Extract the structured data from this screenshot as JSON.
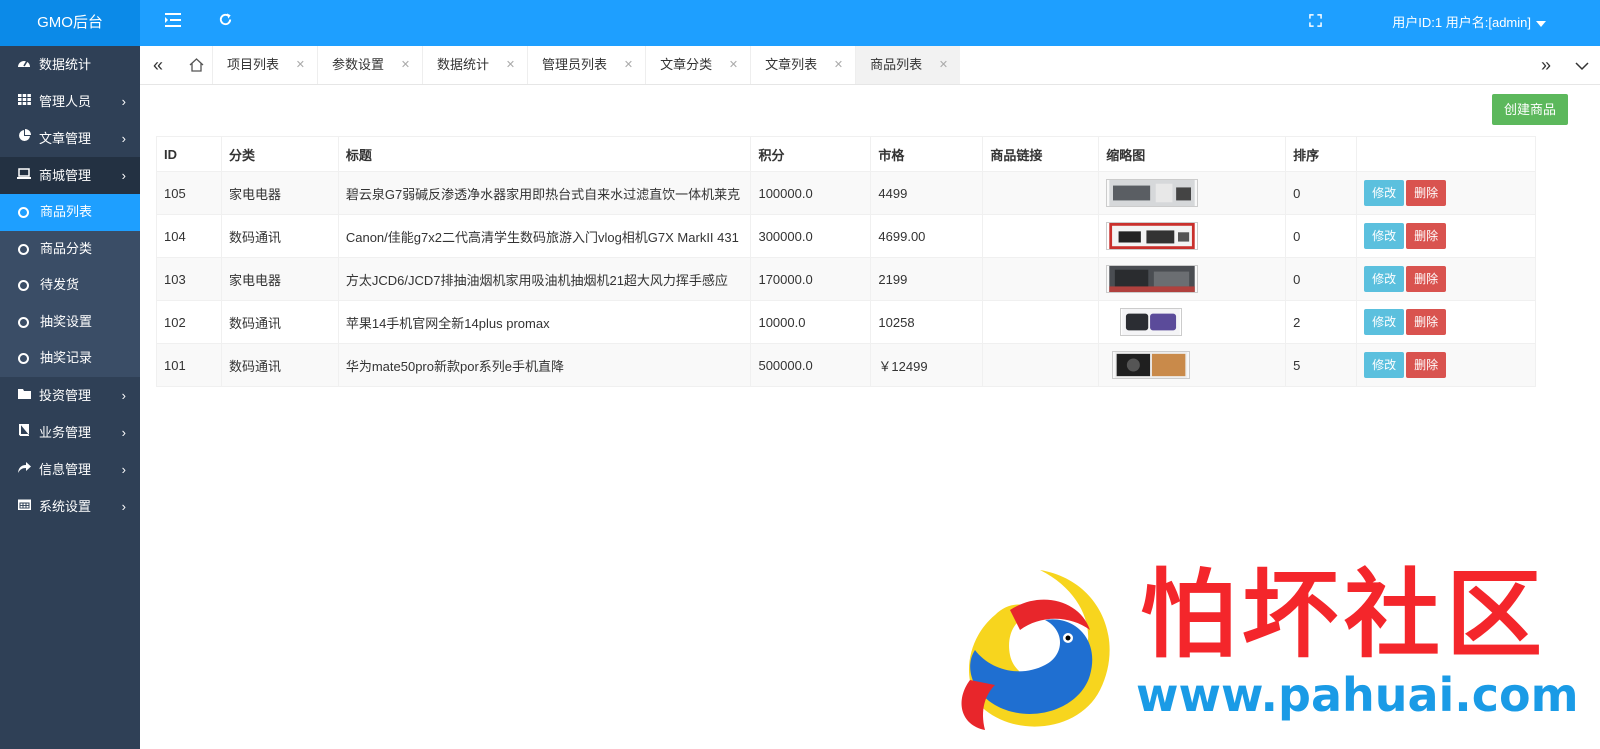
{
  "header": {
    "brand": "GMO后台",
    "user_info": "用户ID:1 用户名:[admin]"
  },
  "sidebar": {
    "items": [
      {
        "label": "数据统计",
        "icon": "dashboard-icon"
      },
      {
        "label": "管理人员",
        "icon": "grid-icon"
      },
      {
        "label": "文章管理",
        "icon": "pie-chart-icon"
      },
      {
        "label": "商城管理",
        "icon": "laptop-icon"
      },
      {
        "label": "投资管理",
        "icon": "folder-icon"
      },
      {
        "label": "业务管理",
        "icon": "book-icon"
      },
      {
        "label": "信息管理",
        "icon": "share-icon"
      },
      {
        "label": "系统设置",
        "icon": "calendar-icon"
      }
    ],
    "mall_sub": [
      "商品列表",
      "商品分类",
      "待发货",
      "抽奖设置",
      "抽奖记录"
    ]
  },
  "tabs": [
    "项目列表",
    "参数设置",
    "数据统计",
    "管理员列表",
    "文章分类",
    "文章列表",
    "商品列表"
  ],
  "content": {
    "create_label": "创建商品",
    "columns": [
      "ID",
      "分类",
      "标题",
      "积分",
      "市格",
      "商品链接",
      "缩略图",
      "排序",
      ""
    ],
    "edit_label": "修改",
    "delete_label": "删除",
    "rows": [
      {
        "id": "105",
        "category": "家电电器",
        "title": "碧云泉G7弱碱反渗透净水器家用即热台式自来水过滤直饮一体机莱克",
        "points": "100000.0",
        "price": "4499",
        "link": "",
        "sort": "0"
      },
      {
        "id": "104",
        "category": "数码通讯",
        "title": "Canon/佳能g7x2二代高清学生数码旅游入门vlog相机G7X MarkII 431",
        "points": "300000.0",
        "price": "4699.00",
        "link": "",
        "sort": "0"
      },
      {
        "id": "103",
        "category": "家电电器",
        "title": "方太JCD6/JCD7排抽油烟机家用吸油机抽烟机21超大风力挥手感应",
        "points": "170000.0",
        "price": "2199",
        "link": "",
        "sort": "0"
      },
      {
        "id": "102",
        "category": "数码通讯",
        "title": "苹果14手机官网全新14plus promax",
        "points": "10000.0",
        "price": "10258",
        "link": "",
        "sort": "2"
      },
      {
        "id": "101",
        "category": "数码通讯",
        "title": "华为mate50pro新款por系列e手机直降",
        "points": "500000.0",
        "price": "￥12499",
        "link": "",
        "sort": "5"
      }
    ]
  },
  "watermark": {
    "text": "怕坏社区",
    "url": "www.pahuai.com"
  }
}
